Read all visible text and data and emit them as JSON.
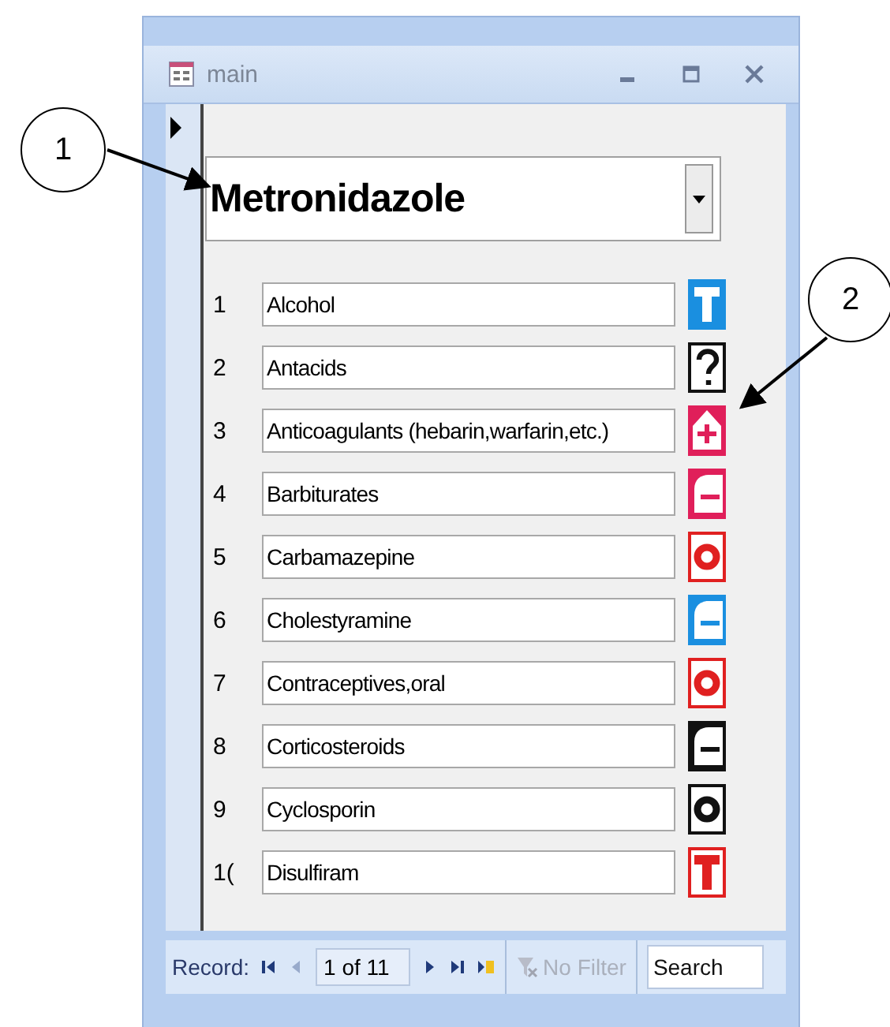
{
  "window": {
    "title": "main"
  },
  "combo": {
    "value": "Metronidazole"
  },
  "rows": [
    {
      "number": "1",
      "label": "Alcohol",
      "kind": "solid-tee",
      "color": "#1a8fe0"
    },
    {
      "number": "2",
      "label": "Antacids",
      "kind": "outline-question",
      "color": "#111111"
    },
    {
      "number": "3",
      "label": "Anticoagulants (hebarin,warfarin,etc.)",
      "kind": "solid-plus",
      "color": "#e01f5a"
    },
    {
      "number": "4",
      "label": "Barbiturates",
      "kind": "solid-minus",
      "color": "#e01f5a"
    },
    {
      "number": "5",
      "label": "Carbamazepine",
      "kind": "outline-ring",
      "color": "#e02020"
    },
    {
      "number": "6",
      "label": "Cholestyramine",
      "kind": "solid-minus",
      "color": "#1a8fe0"
    },
    {
      "number": "7",
      "label": "Contraceptives,oral",
      "kind": "outline-ring",
      "color": "#e02020"
    },
    {
      "number": "8",
      "label": "Corticosteroids",
      "kind": "solid-minus",
      "color": "#111111"
    },
    {
      "number": "9",
      "label": "Cyclosporin",
      "kind": "outline-ring",
      "color": "#111111"
    },
    {
      "number": "1(",
      "label": "Disulfiram",
      "kind": "outline-tee",
      "color": "#e02020"
    }
  ],
  "navigation": {
    "label": "Record:",
    "position": "1 of 11",
    "buttons": [
      {
        "kind": "first",
        "disabled": false
      },
      {
        "kind": "prev",
        "disabled": true
      },
      {
        "kind": "next",
        "disabled": false
      },
      {
        "kind": "last",
        "disabled": false
      },
      {
        "kind": "new",
        "disabled": false
      }
    ],
    "filter": {
      "label": "No Filter",
      "disabled": true
    },
    "search": {
      "placeholder": "Search"
    }
  },
  "callouts": [
    "1",
    "2"
  ]
}
